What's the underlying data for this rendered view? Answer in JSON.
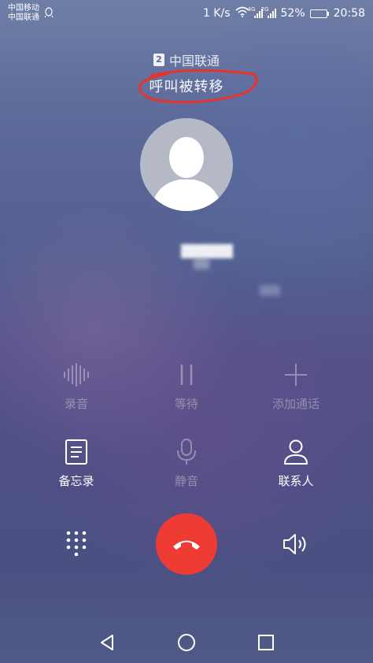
{
  "status_bar": {
    "carrier1": "中国移动",
    "carrier2": "中国联通",
    "speed": "1 K/s",
    "net1": "4G",
    "net2": "2G",
    "battery": "52%",
    "battery_level": 0.52,
    "time": "20:58"
  },
  "call": {
    "sim_slot": "2",
    "carrier": "中国联通",
    "status": "呼叫被转移"
  },
  "controls": {
    "record": "录音",
    "hold": "等待",
    "add_call": "添加通话",
    "notes": "备忘录",
    "mute": "静音",
    "contacts": "联系人"
  },
  "colors": {
    "end_call": "#ee3b33",
    "annotation": "#e8322a"
  }
}
